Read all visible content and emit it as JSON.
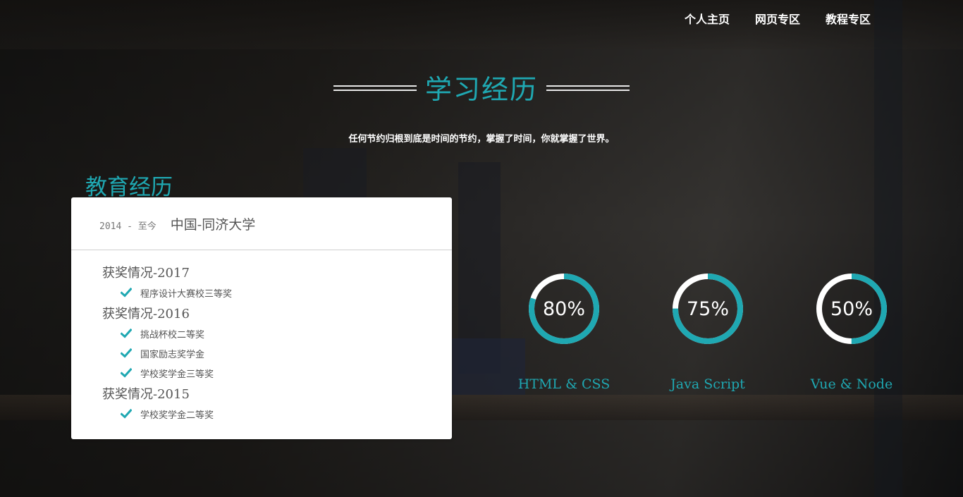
{
  "nav": {
    "items": [
      "个人主页",
      "网页专区",
      "教程专区"
    ]
  },
  "section": {
    "title": "学习经历",
    "subtitle": "任何节约归根到底是时间的节约，掌握了时间，你就掌握了世界。"
  },
  "education": {
    "heading": "教育经历",
    "period": "2014 - 至今",
    "school": "中国-同济大学",
    "awards": [
      {
        "year": "获奖情况-2017",
        "items": [
          "程序设计大赛校三等奖"
        ]
      },
      {
        "year": "获奖情况-2016",
        "items": [
          "挑战杯校二等奖",
          "国家励志奖学金",
          "学校奖学金三等奖"
        ]
      },
      {
        "year": "获奖情况-2015",
        "items": [
          "学校奖学金二等奖"
        ]
      }
    ]
  },
  "skills": [
    {
      "label": "HTML & CSS",
      "percent_text": "80%",
      "value": 0.8
    },
    {
      "label": "Java Script",
      "percent_text": "75%",
      "value": 0.75
    },
    {
      "label": "Vue & Node",
      "percent_text": "50%",
      "value": 0.5
    }
  ],
  "colors": {
    "accent": "#1fa8b2",
    "ring_track": "#ffffff",
    "check": "#1fa8b2"
  }
}
